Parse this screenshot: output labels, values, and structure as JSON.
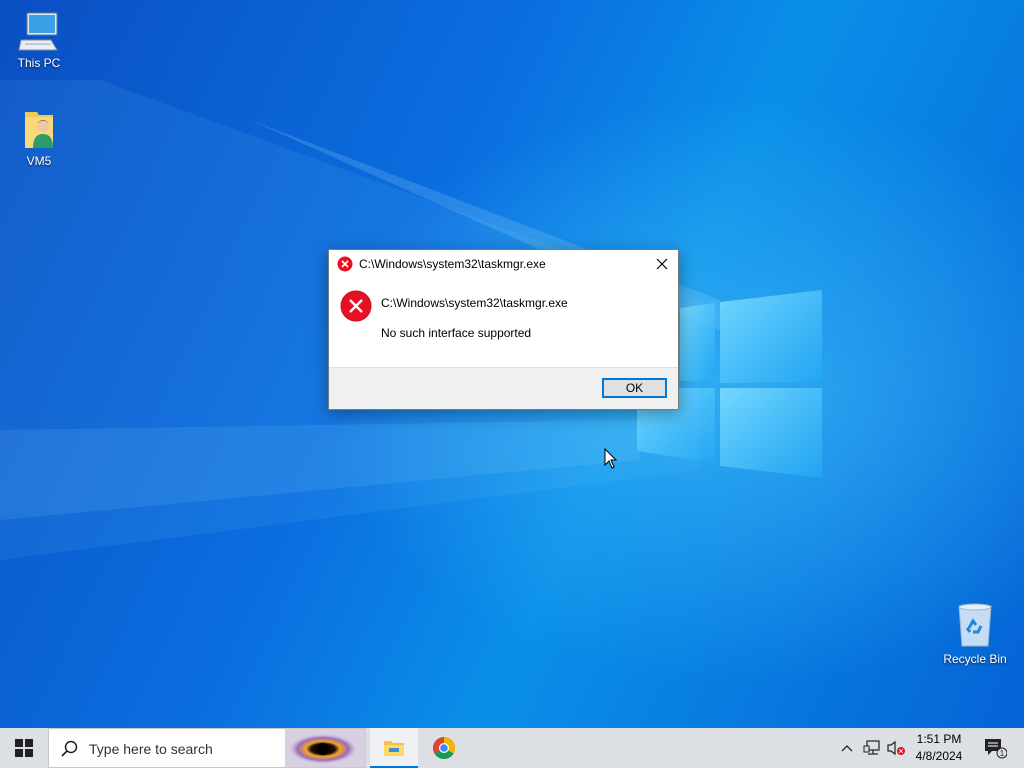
{
  "desktop": {
    "icons": [
      {
        "label": "This PC"
      },
      {
        "label": "VM5"
      },
      {
        "label": "Recycle Bin"
      }
    ]
  },
  "dialog": {
    "title": "C:\\Windows\\system32\\taskmgr.exe",
    "path": "C:\\Windows\\system32\\taskmgr.exe",
    "message": "No such interface supported",
    "ok_label": "OK"
  },
  "taskbar": {
    "search_placeholder": "Type here to search",
    "apps": [
      {
        "name": "File Explorer",
        "icon": "file-explorer-icon"
      },
      {
        "name": "Google Chrome",
        "icon": "chrome-icon"
      }
    ],
    "clock_time": "1:51 PM",
    "clock_date": "4/8/2024",
    "notification_count": "1"
  },
  "colors": {
    "accent": "#0078d7",
    "error_red": "#e81123",
    "taskbar_bg": "#dcdfe4"
  }
}
